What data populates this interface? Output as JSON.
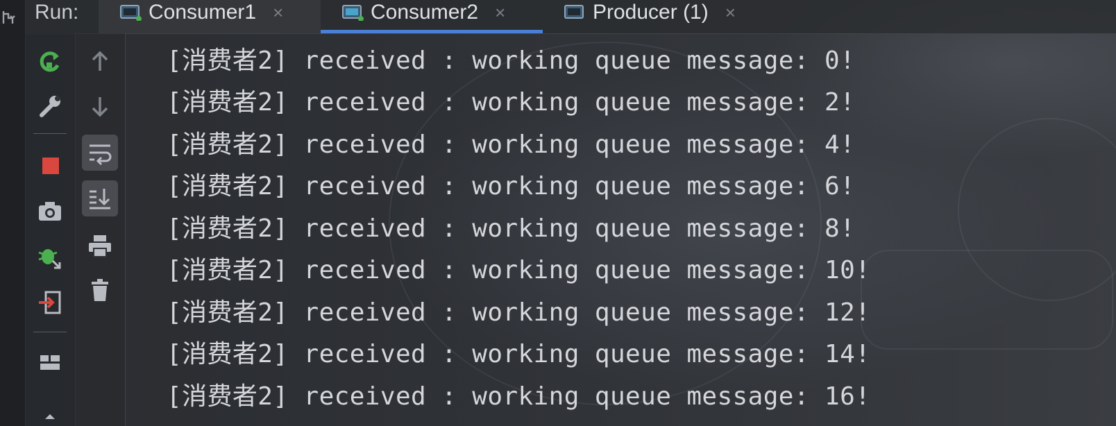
{
  "run": {
    "label": "Run:"
  },
  "tabs": [
    {
      "title": "Consumer1",
      "close": "×",
      "active": false,
      "icon": "run-config-icon"
    },
    {
      "title": "Consumer2",
      "close": "×",
      "active": true,
      "icon": "run-config-icon"
    },
    {
      "title": "Producer (1)",
      "close": "×",
      "active": false,
      "icon": "run-config-icon"
    }
  ],
  "toolbar": {
    "main_buttons": [
      "rerun-icon",
      "wrench-icon",
      "stop-icon",
      "camera-icon",
      "debug-export-icon",
      "exit-icon",
      "layout-icon",
      "caret-up-icon"
    ],
    "secondary_buttons": [
      "up-arrow-icon",
      "down-arrow-icon",
      "soft-wrap-icon",
      "scroll-to-end-icon",
      "print-icon",
      "trash-icon"
    ]
  },
  "console": {
    "lines": [
      "[消费者2] received : working queue message: 0!",
      "[消费者2] received : working queue message: 2!",
      "[消费者2] received : working queue message: 4!",
      "[消费者2] received : working queue message: 6!",
      "[消费者2] received : working queue message: 8!",
      "[消费者2] received : working queue message: 10!",
      "[消费者2] received : working queue message: 12!",
      "[消费者2] received : working queue message: 14!",
      "[消费者2] received : working queue message: 16!"
    ]
  },
  "colors": {
    "accent": "#4a7fd6",
    "rerun": "#4caf50",
    "stop": "#d9473f",
    "text": "#d4d6da"
  }
}
